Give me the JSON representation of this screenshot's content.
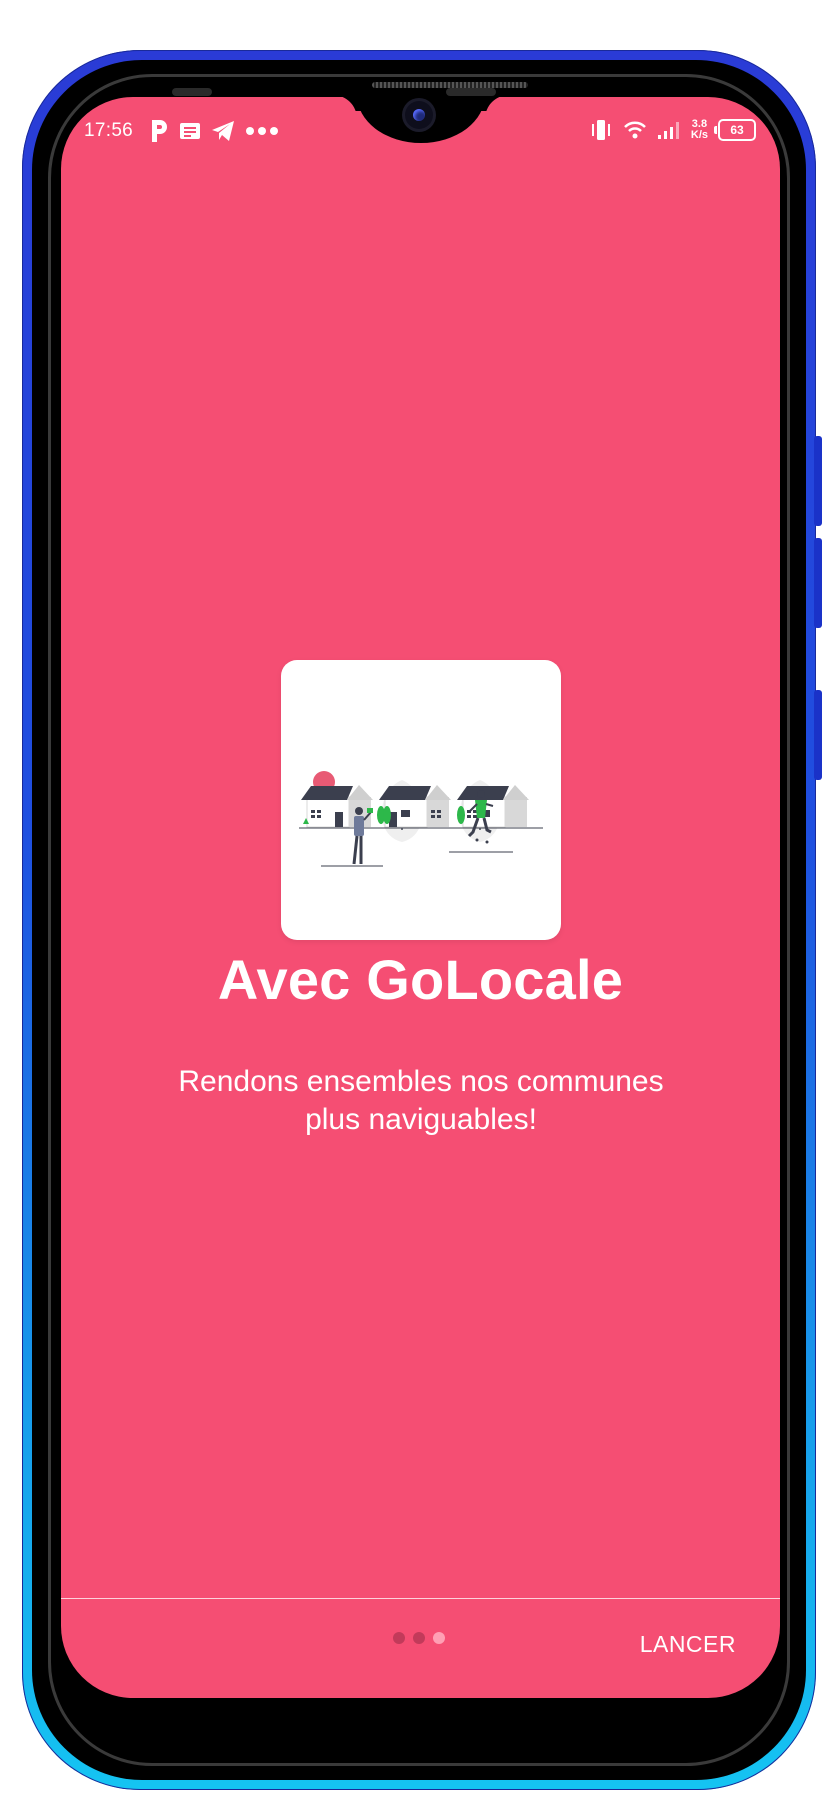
{
  "status_bar": {
    "time": "17:56",
    "left_icons": [
      "parking-icon",
      "news-icon",
      "telegram-icon",
      "more-dots-icon"
    ],
    "net_speed_value": "3.8",
    "net_speed_unit": "K/s",
    "battery": "63"
  },
  "onboarding": {
    "title": "Avec GoLocale",
    "subtitle_line1": "Rendons ensembles nos communes",
    "subtitle_line2": "plus naviguables!",
    "page_count": 3,
    "active_page": 3,
    "launch_label": "LANCER"
  },
  "colors": {
    "screen_background": "#f54e73",
    "card_background": "#ffffff",
    "illustration_accent": "#e85a74",
    "illustration_green": "#2db84a",
    "roof": "#3b3f4e"
  }
}
